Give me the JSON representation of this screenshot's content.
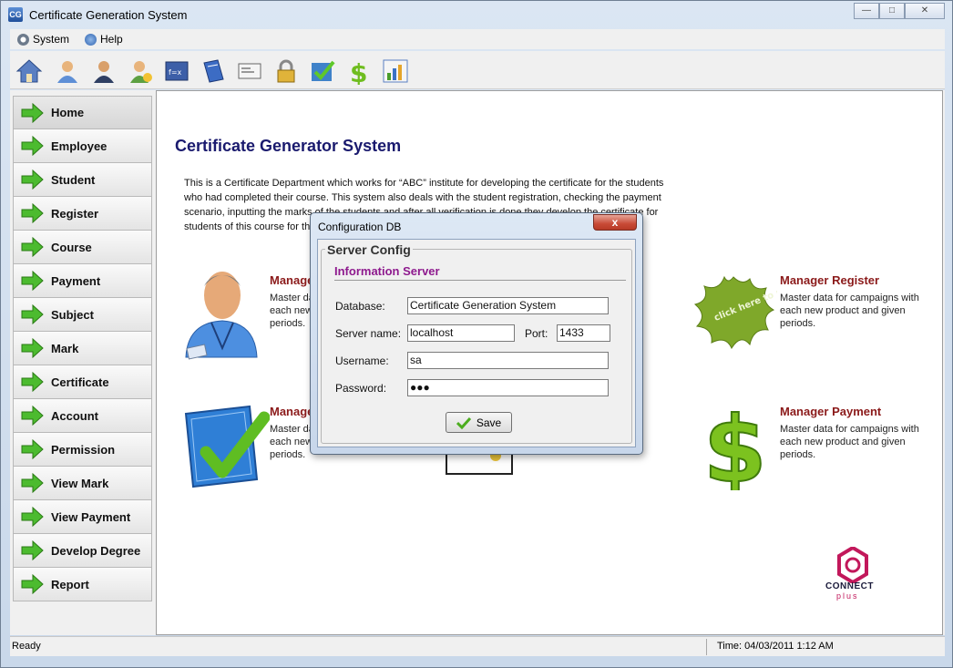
{
  "window": {
    "title": "Certificate Generation System",
    "app_icon_text": "CG",
    "controls": [
      "minimize",
      "maximize",
      "close"
    ]
  },
  "menu": {
    "items": [
      {
        "label": "System",
        "icon": "gear-icon"
      },
      {
        "label": "Help",
        "icon": "help-icon"
      }
    ]
  },
  "toolbar": {
    "icons": [
      "home-icon",
      "employee-icon",
      "student-icon",
      "register-user-icon",
      "course-icon",
      "subject-book-icon",
      "certificate-icon",
      "lock-icon",
      "mark-check-icon",
      "dollar-icon",
      "chart-icon"
    ]
  },
  "sidebar": {
    "items": [
      {
        "label": "Home"
      },
      {
        "label": "Employee"
      },
      {
        "label": "Student"
      },
      {
        "label": "Register"
      },
      {
        "label": "Course"
      },
      {
        "label": "Payment"
      },
      {
        "label": "Subject"
      },
      {
        "label": "Mark"
      },
      {
        "label": "Certificate"
      },
      {
        "label": "Account"
      },
      {
        "label": "Permission"
      },
      {
        "label": "View Mark"
      },
      {
        "label": "View Payment"
      },
      {
        "label": "Develop Degree"
      },
      {
        "label": "Report"
      }
    ]
  },
  "main": {
    "title": "Certificate Generator System",
    "description": "This is a Certificate Department which works for “ABC” institute for developing the certificate for the students who had completed their course. This system also deals with the student registration, checking the payment scenario, inputting the marks of the students and after all verification is done they develop the certificate for students of this course for the students.",
    "tiles": [
      {
        "title": "Manager",
        "desc": "Master data for campaigns with each new product and given periods.",
        "icon": "employee-person-icon"
      },
      {
        "title": "Manager Register",
        "desc": "Master data for campaigns with each new product and given periods.",
        "icon": "click-here-to-register-splat-icon"
      },
      {
        "title": "Manager",
        "desc": "Master data for campaigns with each new product and given periods.",
        "icon": "blueprint-check-icon"
      },
      {
        "title": "Manager Payment",
        "desc": "Master data for campaigns with each new product and given periods.",
        "icon": "green-dollar-icon"
      }
    ],
    "splat_text": "click here to register",
    "brand": {
      "line1": "CONNECT",
      "line2": "plus"
    }
  },
  "status": {
    "ready": "Ready",
    "time": "Time: 04/03/2011 1:12 AM"
  },
  "dialog": {
    "title": "Configuration DB",
    "close_label": "x",
    "group_title": "Server Config",
    "section_title": "Information Server",
    "fields": {
      "database_label": "Database:",
      "database_value": "Certificate Generation System",
      "server_label": "Server name:",
      "server_value": "localhost",
      "port_label": "Port:",
      "port_value": "1433",
      "username_label": "Username:",
      "username_value": "sa",
      "password_label": "Password:",
      "password_value": "●●●"
    },
    "save_label": "Save"
  },
  "colors": {
    "title_blue": "#1a1a6e",
    "tile_title_red": "#8b1a1a",
    "section_purple": "#8e1a8e",
    "arrow_green": "#3fae2a"
  }
}
